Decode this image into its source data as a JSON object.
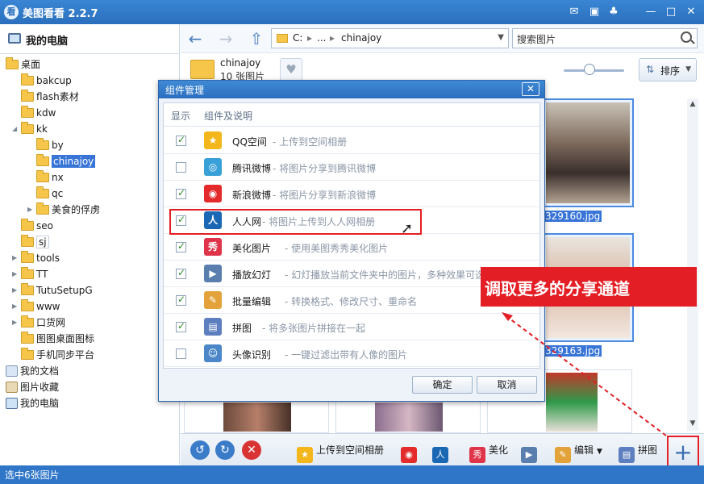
{
  "app": {
    "logo_text": "看",
    "title": "美图看看 2.2.7"
  },
  "sidebar": {
    "title": "我的电脑",
    "tree": [
      {
        "label": "桌面",
        "icon": "folder"
      },
      {
        "label": "bakcup",
        "icon": "folder"
      },
      {
        "label": "flash素材",
        "icon": "folder"
      },
      {
        "label": "kdw",
        "icon": "folder"
      },
      {
        "label": "kk",
        "icon": "folder"
      },
      {
        "label": "by",
        "icon": "folder"
      },
      {
        "label": "chinajoy",
        "icon": "folder"
      },
      {
        "label": "nx",
        "icon": "folder"
      },
      {
        "label": "qc",
        "icon": "folder"
      },
      {
        "label": "美食的俘虏",
        "icon": "folder"
      },
      {
        "label": "seo",
        "icon": "folder"
      },
      {
        "label": "sj",
        "icon": "folder"
      },
      {
        "label": "tools",
        "icon": "folder"
      },
      {
        "label": "TT",
        "icon": "folder"
      },
      {
        "label": "TutuSetupG",
        "icon": "folder"
      },
      {
        "label": "www",
        "icon": "folder"
      },
      {
        "label": "口货网",
        "icon": "folder"
      },
      {
        "label": "图图桌面图标",
        "icon": "folder"
      },
      {
        "label": "手机同步平台",
        "icon": "folder"
      },
      {
        "label": "我的文档",
        "icon": "documents-icon"
      },
      {
        "label": "图片收藏",
        "icon": "pictures-icon"
      },
      {
        "label": "我的电脑",
        "icon": "computer-icon"
      }
    ]
  },
  "nav": {
    "path": [
      "C:",
      "...",
      "chinajoy"
    ],
    "search_text": "搜索图片"
  },
  "folder_info": {
    "name": "chinajoy",
    "count": "10 张图片",
    "sort_label": "排序"
  },
  "thumbnails": {
    "file1": "329160.jpg",
    "file2": "329163.jpg"
  },
  "dialog": {
    "title": "组件管理",
    "col_show": "显示",
    "col_desc": "组件及说明",
    "plugins": [
      {
        "name": "QQ空间",
        "desc": "- 上传到空间相册",
        "checked": true,
        "icon": "qzone-icon",
        "color": "#f3b61b"
      },
      {
        "name": "腾讯微博",
        "desc": "- 将图片分享到腾讯微博",
        "checked": false,
        "icon": "tencent-weibo-icon",
        "color": "#3aa0d8"
      },
      {
        "name": "新浪微博",
        "desc": "- 将图片分享到新浪微博",
        "checked": true,
        "icon": "sina-weibo-icon",
        "color": "#e32b2b"
      },
      {
        "name": "人人网",
        "desc": "- 将图片上传到人人网相册",
        "checked": true,
        "icon": "renren-icon",
        "color": "#1a67b3"
      },
      {
        "name": "美化图片",
        "desc": "- 使用美图秀秀美化图片",
        "checked": true,
        "icon": "xiuxiu-icon",
        "color": "#e0344a"
      },
      {
        "name": "播放幻灯",
        "desc": "- 幻灯播放当前文件夹中的图片，多种效果可选",
        "checked": true,
        "icon": "slideshow-icon",
        "color": "#5a7fae"
      },
      {
        "name": "批量编辑",
        "desc": "- 转换格式、修改尺寸、重命名",
        "checked": true,
        "icon": "batch-edit-icon",
        "color": "#e3a23a"
      },
      {
        "name": "拼图",
        "desc": "- 将多张图片拼接在一起",
        "checked": true,
        "icon": "collage-icon",
        "color": "#5d7fbf"
      },
      {
        "name": "头像识别",
        "desc": "- 一键过滤出带有人像的图片",
        "checked": false,
        "icon": "face-detect-icon",
        "color": "#4a86c8"
      }
    ],
    "ok": "确定",
    "cancel": "取消"
  },
  "bottombar": {
    "qzone_label": "上传到空间相册",
    "beautify_label": "美化",
    "edit_label": "编辑",
    "collage_label": "拼图",
    "add_label": "+"
  },
  "callout": {
    "text": "调取更多的分享通道"
  },
  "status": {
    "text": "选中6张图片"
  },
  "colors": {
    "accent": "#2f76c8",
    "highlight": "#e31e24",
    "selection": "#3875d7"
  }
}
